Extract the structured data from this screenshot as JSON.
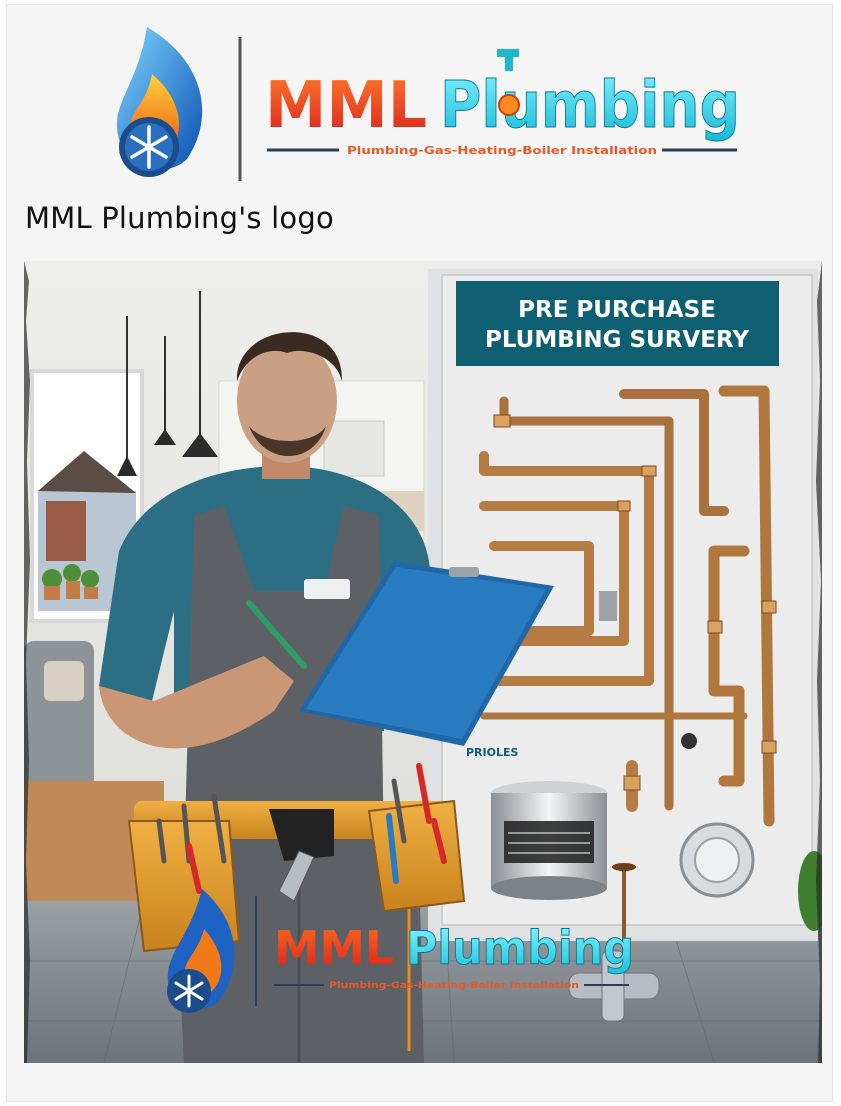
{
  "logo": {
    "brand_part1": "MML",
    "brand_part2": "Plumbing",
    "tagline": "Plumbing-Gas-Heating-Boiler Installation"
  },
  "caption": "MML Plumbing's logo",
  "poster": {
    "heading_line1": "PRE PURCHASE",
    "heading_line2": "PLUMBING SURVERY",
    "label_small": "PRIOLES"
  },
  "watermark": {
    "brand_part1": "MML",
    "brand_part2": "Plumbing",
    "tagline": "Plumbing-Gas-Heating-Boiler Installation"
  },
  "colors": {
    "page": "#f5f5f5",
    "brand_red": "#e8361c",
    "brand_cyan": "#33d6e6",
    "poster_teal": "#0f5f72",
    "shirt": "#2c6f84",
    "overalls": "#5d6166"
  },
  "icons": [
    "flame-icon",
    "snowflake-icon",
    "faucet-icon"
  ]
}
